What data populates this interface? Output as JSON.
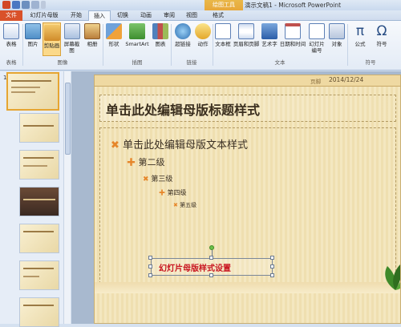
{
  "window": {
    "title": "演示文稿1 - Microsoft PowerPoint",
    "context_tab": "绘图工具"
  },
  "tabs": [
    {
      "label": "文件"
    },
    {
      "label": "幻灯片母版"
    },
    {
      "label": "开始"
    },
    {
      "label": "插入"
    },
    {
      "label": "切换"
    },
    {
      "label": "动画"
    },
    {
      "label": "审阅"
    },
    {
      "label": "视图"
    },
    {
      "label": "格式"
    }
  ],
  "ribbon": {
    "groups": {
      "table": "表格",
      "images": "图像",
      "illustrations": "插图",
      "links": "链接",
      "text": "文本",
      "symbols": "符号"
    },
    "buttons": {
      "table": "表格",
      "picture": "图片",
      "clipart": "剪贴画",
      "screenshot": "屏幕截图",
      "album": "相册",
      "shapes": "形状",
      "smartart": "SmartArt",
      "chart": "图表",
      "hyperlink": "超链接",
      "action": "动作",
      "textbox": "文本框",
      "header_footer": "页眉和页脚",
      "wordart": "艺术字",
      "datetime": "日期和时间",
      "slide_number": "幻灯片编号",
      "object": "对象",
      "equation": "公式",
      "symbol": "符号"
    }
  },
  "thumbnails": {
    "first_number": "1"
  },
  "slide": {
    "date_label": "页脚",
    "date": "2014/12/24",
    "title": "单击此处编辑母版标题样式",
    "levels": [
      "单击此处编辑母版文本样式",
      "第二级",
      "第三级",
      "第四级",
      "第五级"
    ],
    "footer_text": "幻灯片母版样式设置"
  },
  "colors": {
    "accent": "#e6862a",
    "footer_text": "#c8141f",
    "file_tab": "#d9512a"
  }
}
